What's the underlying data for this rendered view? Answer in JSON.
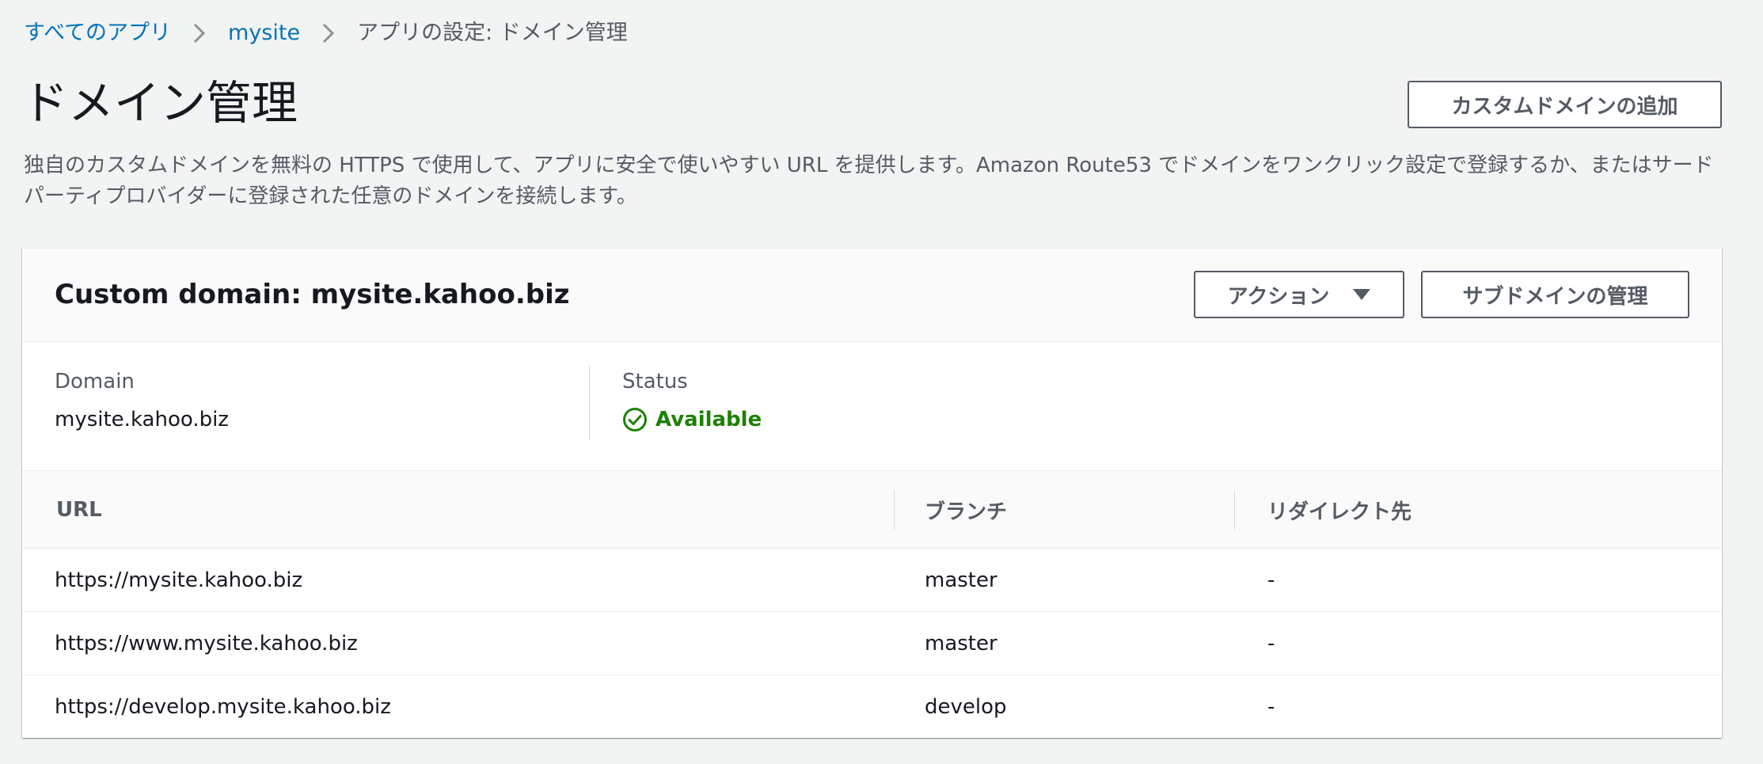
{
  "breadcrumb": {
    "items": [
      "すべてのアプリ",
      "mysite"
    ],
    "current": "アプリの設定: ドメイン管理"
  },
  "header": {
    "title": "ドメイン管理",
    "add_domain_label": "カスタムドメインの追加",
    "description": "独自のカスタムドメインを無料の HTTPS で使用して、アプリに安全で使いやすい URL を提供します。Amazon Route53 でドメインをワンクリック設定で登録するか、またはサードパーティプロバイダーに登録された任意のドメインを接続します。"
  },
  "card": {
    "title": "Custom domain: mysite.kahoo.biz",
    "actions_label": "アクション",
    "subdomains_label": "サブドメインの管理",
    "details": {
      "domain_label": "Domain",
      "domain_value": "mysite.kahoo.biz",
      "status_label": "Status",
      "status_value": "Available"
    },
    "table": {
      "columns": [
        "URL",
        "ブランチ",
        "リダイレクト先"
      ],
      "rows": [
        {
          "url": "https://mysite.kahoo.biz",
          "branch": "master",
          "redirect": "-"
        },
        {
          "url": "https://www.mysite.kahoo.biz",
          "branch": "master",
          "redirect": "-"
        },
        {
          "url": "https://develop.mysite.kahoo.biz",
          "branch": "develop",
          "redirect": "-"
        }
      ]
    }
  },
  "colors": {
    "link": "#0073bb",
    "status_ok": "#1d8102",
    "text": "#16191f",
    "secondary_text": "#545b64",
    "background": "#f2f3f3"
  },
  "icons": {
    "breadcrumb_separator": "chevron-right-icon",
    "status": "check-circle-icon",
    "dropdown": "caret-down-icon"
  }
}
